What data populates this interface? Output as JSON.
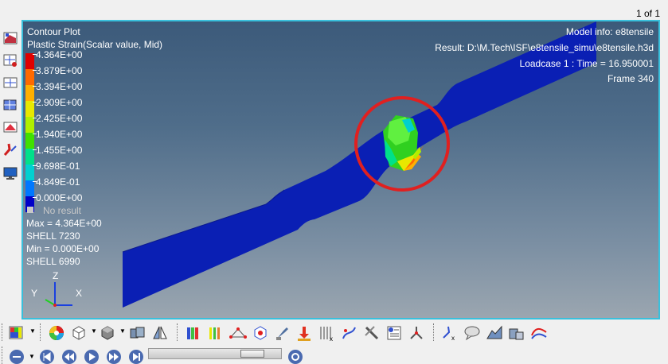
{
  "page_counter": "1 of 1",
  "plot": {
    "title": "Contour Plot",
    "subtitle": "Plastic Strain(Scalar value, Mid)",
    "model_info": "Model info: e8tensile",
    "result": "Result: D:\\M.Tech\\ISF\\e8tensile_simu\\e8tensile.h3d",
    "loadcase": "Loadcase 1 : Time = 16.950001",
    "frame": "Frame 340"
  },
  "legend": {
    "levels": [
      "4.364E+00",
      "3.879E+00",
      "3.394E+00",
      "2.909E+00",
      "2.425E+00",
      "1.940E+00",
      "1.455E+00",
      "9.698E-01",
      "4.849E-01",
      "0.000E+00"
    ],
    "colors": [
      "#e00000",
      "#ff6a00",
      "#ffb000",
      "#e8e800",
      "#b0f000",
      "#40e000",
      "#00e08a",
      "#00d0d0",
      "#0078ff",
      "#0000c8"
    ],
    "no_result": "No result"
  },
  "stats": {
    "max": "Max = 4.364E+00",
    "max_element": "SHELL 7230",
    "min": "Min = 0.000E+00",
    "min_element": "SHELL 6990"
  },
  "triad": {
    "z": "Z",
    "y": "Y",
    "x": "X"
  },
  "colors": {
    "specimen": "#0a1fb4",
    "viewport_border": "#39c0dc",
    "highlight_circle": "#e02020"
  }
}
